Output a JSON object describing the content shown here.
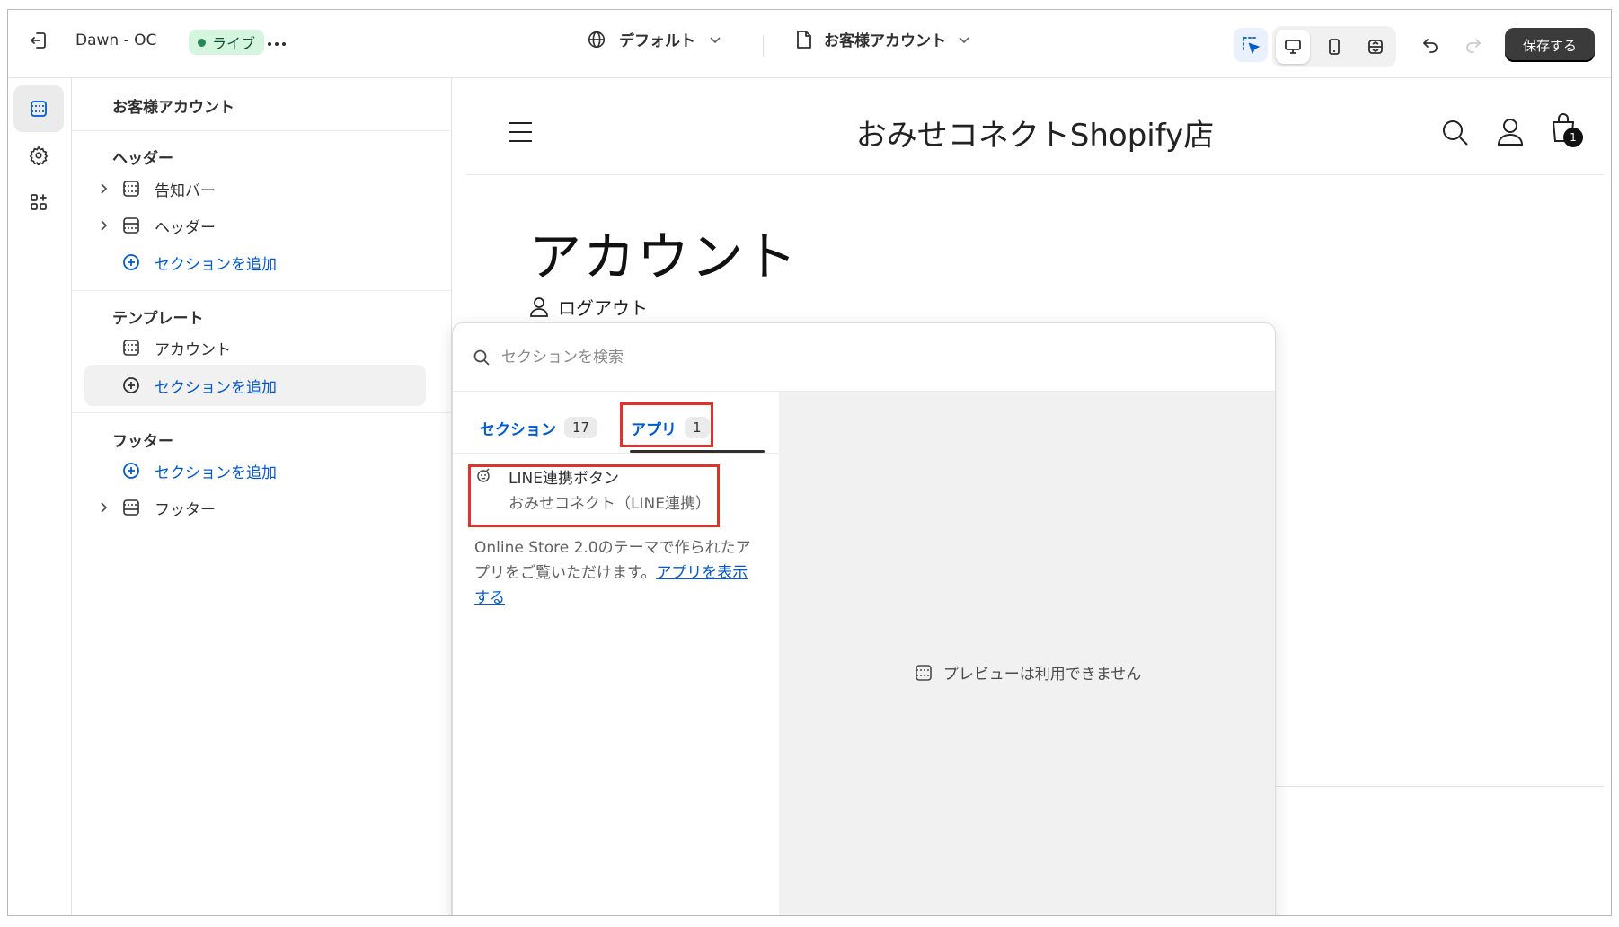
{
  "topbar": {
    "theme_name": "Dawn - OC",
    "live_badge": "ライブ",
    "market_selector": "デフォルト",
    "page_selector": "お客様アカウント",
    "save_label": "保存する"
  },
  "sidebar": {
    "title": "お客様アカウント",
    "groups": [
      {
        "heading": "ヘッダー",
        "items": [
          "告知バー",
          "ヘッダー"
        ],
        "add_label": "セクションを追加"
      },
      {
        "heading": "テンプレート",
        "items": [
          "アカウント"
        ],
        "add_label": "セクションを追加"
      },
      {
        "heading": "フッター",
        "items": [
          "フッター"
        ],
        "add_label": "セクションを追加"
      }
    ]
  },
  "preview": {
    "store_name": "おみせコネクトShopify店",
    "cart_count": "1",
    "page_title": "アカウント",
    "logout_label": "ログアウト"
  },
  "picker": {
    "search_placeholder": "セクションを検索",
    "tabs": [
      {
        "label": "セクション",
        "count": "17",
        "active": false
      },
      {
        "label": "アプリ",
        "count": "1",
        "active": true
      }
    ],
    "app_item": {
      "name": "LINE連携ボタン",
      "provider": "おみせコネクト（LINE連携）"
    },
    "note_text": "Online Store 2.0のテーマで作られたアプリをご覧いただけます。",
    "note_link": "アプリを表示する",
    "no_preview_text": "プレビューは利用できません"
  },
  "colors": {
    "highlight": "#e0312b",
    "link": "#005bd3",
    "live_badge_bg": "#d5f5df"
  }
}
